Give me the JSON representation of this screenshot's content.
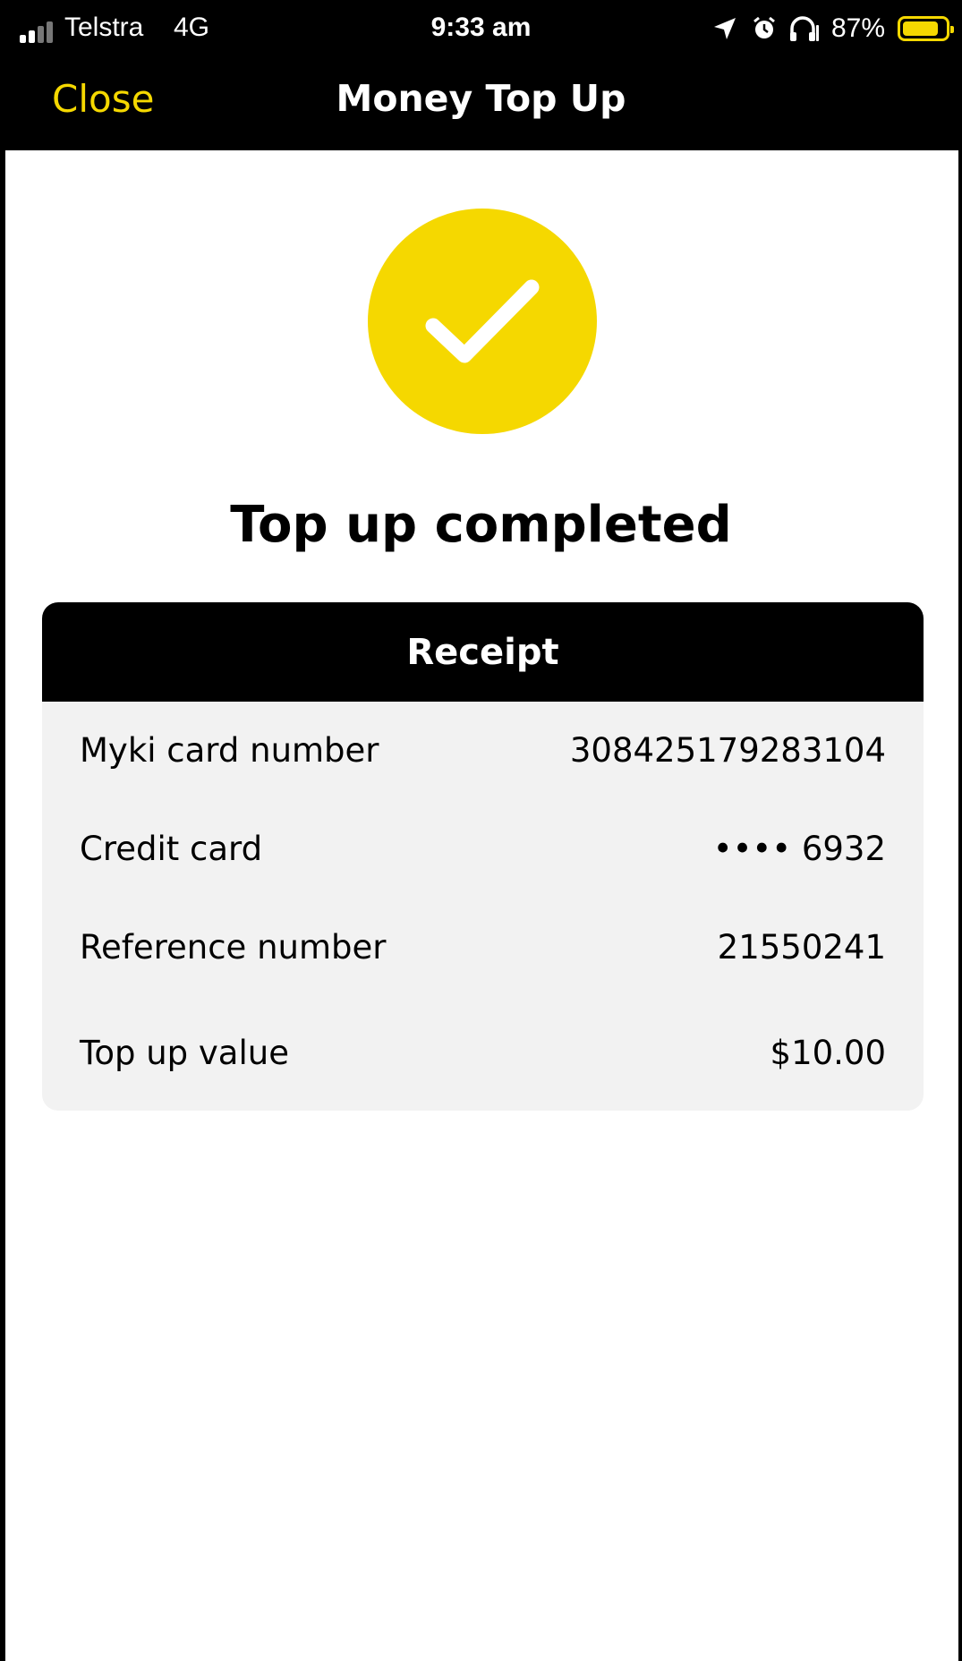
{
  "status_bar": {
    "carrier": "Telstra",
    "network": "4G",
    "time": "9:33 am",
    "battery_percent": "87%",
    "battery_level": 0.87,
    "icons": [
      "location-arrow-icon",
      "alarm-icon",
      "headphones-icon"
    ]
  },
  "nav": {
    "close_label": "Close",
    "title": "Money Top Up"
  },
  "status": {
    "icon": "checkmark-icon",
    "title": "Top up completed"
  },
  "receipt": {
    "title": "Receipt",
    "rows": [
      {
        "label": "Myki card number",
        "value": "308425179283104"
      },
      {
        "label": "Credit card",
        "value": "•••• 6932"
      },
      {
        "label": "Reference number",
        "value": "21550241"
      },
      {
        "label": "Top up value",
        "value": "$10.00"
      }
    ]
  },
  "colors": {
    "accent": "#f5d800",
    "header_bg": "#000000",
    "card_bg": "#f2f2f2"
  }
}
